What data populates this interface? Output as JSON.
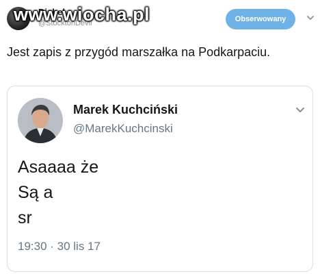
{
  "outer_tweet": {
    "display_name": "Diabeł",
    "handle": "@StocktonDevil",
    "follow_button_label": "Obserwowany",
    "text": "Jest zapis z przygód marszałka na Podkarpaciu."
  },
  "watermark": "www.wiocha.pl",
  "quoted_tweet": {
    "display_name": "Marek Kuchciński",
    "handle": "@MarekKuchcinski",
    "text_lines": [
      "Asaaaa że",
      "Są a",
      "sr"
    ],
    "timestamp": "19:30 · 30 lis 17"
  },
  "colors": {
    "follow_button": "#6fb3e6",
    "secondary_text": "#657786",
    "card_border": "#d9dee3"
  },
  "icons": {
    "outer_menu": "chevron-down-icon",
    "quote_menu": "chevron-down-icon"
  }
}
